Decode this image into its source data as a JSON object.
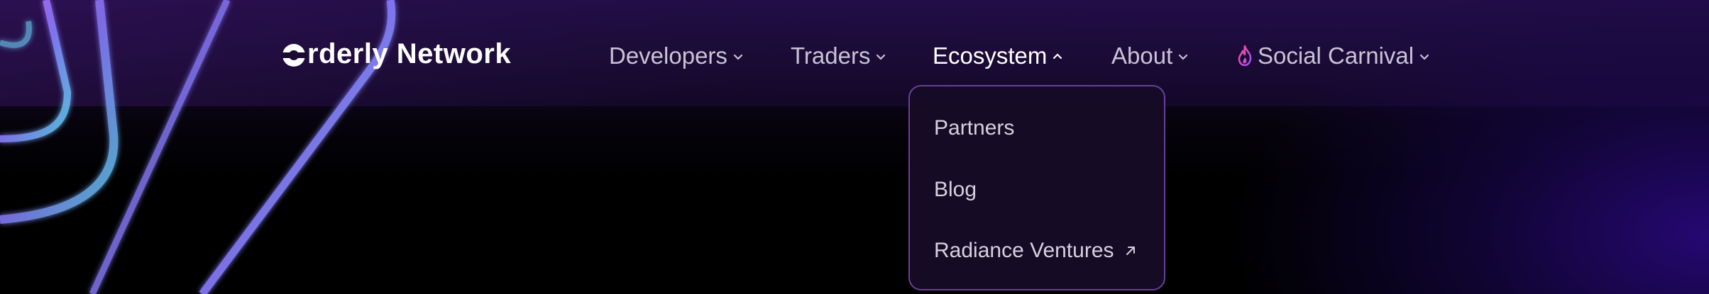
{
  "logo": {
    "icon": "orderly-logo-mark-icon",
    "text": "rderly Network"
  },
  "nav": {
    "items": [
      {
        "label": "Developers",
        "icon": "chevron-down-icon",
        "expanded": false
      },
      {
        "label": "Traders",
        "icon": "chevron-down-icon",
        "expanded": false
      },
      {
        "label": "Ecosystem",
        "icon": "chevron-up-icon",
        "expanded": true
      },
      {
        "label": "About",
        "icon": "chevron-down-icon",
        "expanded": false
      },
      {
        "label": "Social Carnival",
        "icon": "chevron-down-icon",
        "leading_icon": "flame-icon",
        "expanded": false
      }
    ]
  },
  "dropdown": {
    "items": [
      {
        "label": "Partners"
      },
      {
        "label": "Blog"
      },
      {
        "label": "Radiance Ventures",
        "icon": "external-link-arrow-icon"
      }
    ]
  },
  "colors": {
    "nav_text": "#c9c3d6",
    "nav_active": "#ffffff",
    "dropdown_border": "#6a3f98",
    "dropdown_bg": "#160c26",
    "flame_gradient": [
      "#ff4f8a",
      "#a04cff"
    ],
    "accent_purple": "#2a0a7a"
  }
}
